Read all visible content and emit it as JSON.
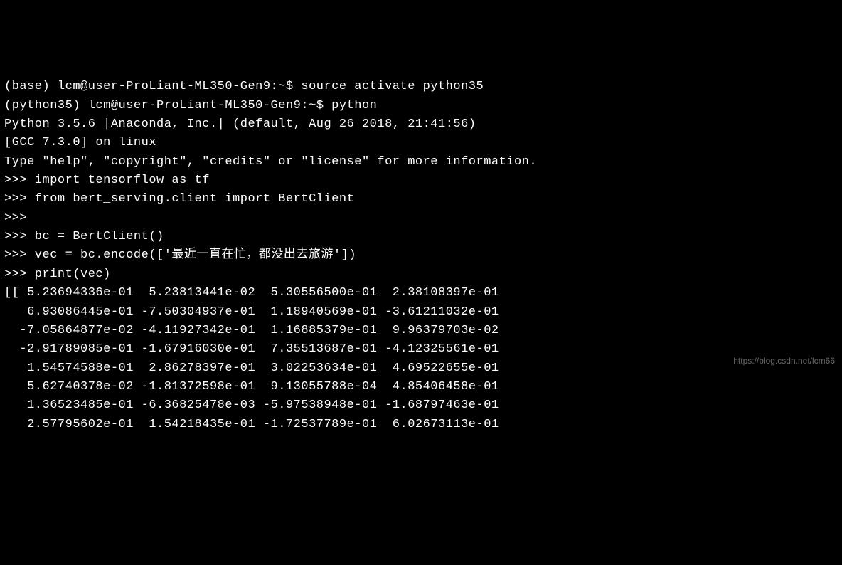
{
  "terminal": {
    "lines": [
      "(base) lcm@user-ProLiant-ML350-Gen9:~$ source activate python35",
      "(python35) lcm@user-ProLiant-ML350-Gen9:~$ python",
      "Python 3.5.6 |Anaconda, Inc.| (default, Aug 26 2018, 21:41:56)",
      "[GCC 7.3.0] on linux",
      "Type \"help\", \"copyright\", \"credits\" or \"license\" for more information.",
      ">>> import tensorflow as tf",
      ">>> from bert_serving.client import BertClient",
      ">>>",
      ">>> bc = BertClient()",
      ">>> vec = bc.encode(['最近一直在忙，都没出去旅游'])",
      ">>> print(vec)",
      "[[ 5.23694336e-01  5.23813441e-02  5.30556500e-01  2.38108397e-01",
      "   6.93086445e-01 -7.50304937e-01  1.18940569e-01 -3.61211032e-01",
      "  -7.05864877e-02 -4.11927342e-01  1.16885379e-01  9.96379703e-02",
      "  -2.91789085e-01 -1.67916030e-01  7.35513687e-01 -4.12325561e-01",
      "   1.54574588e-01  2.86278397e-01  3.02253634e-01  4.69522655e-01",
      "   5.62740378e-02 -1.81372598e-01  9.13055788e-04  4.85406458e-01",
      "   1.36523485e-01 -6.36825478e-03 -5.97538948e-01 -1.68797463e-01",
      "   2.57795602e-01  1.54218435e-01 -1.72537789e-01  6.02673113e-01"
    ]
  },
  "watermark": "https://blog.csdn.net/lcm66"
}
